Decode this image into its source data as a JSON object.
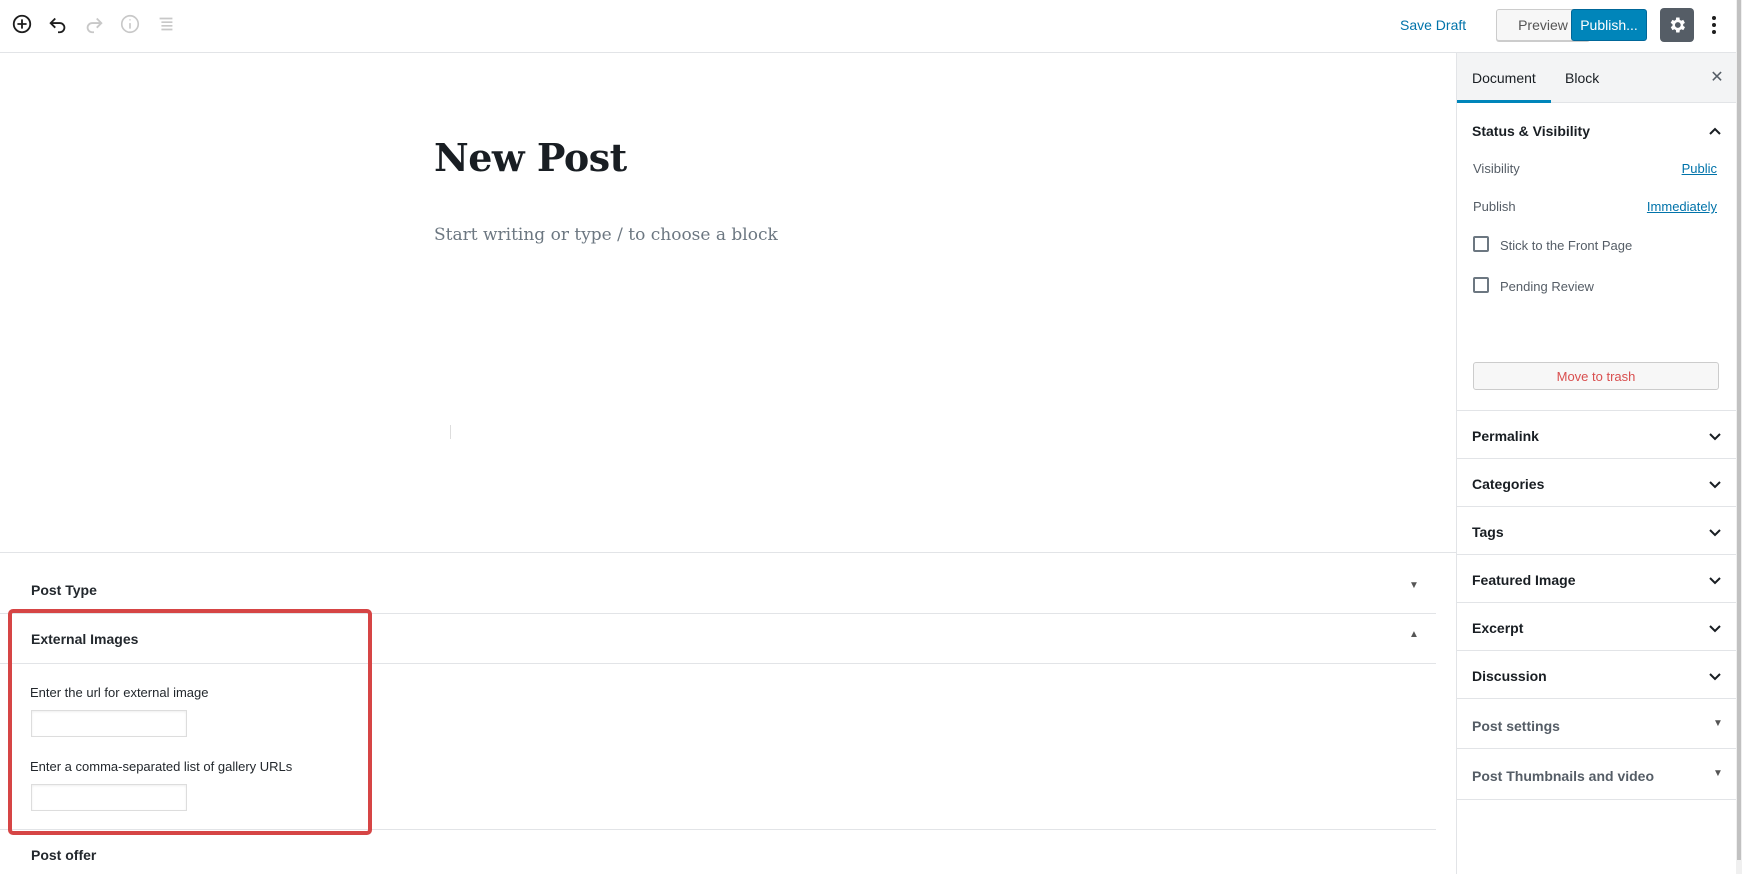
{
  "toolbar": {
    "icons": [
      "add-block-icon",
      "undo-icon",
      "redo-icon",
      "info-icon",
      "block-navigation-icon"
    ],
    "save_draft": "Save Draft",
    "preview": "Preview",
    "publish": "Publish...",
    "settings_icon": "gear-icon",
    "more_icon": "ellipsis-vertical-icon",
    "accent_color": "#0085ba"
  },
  "editor": {
    "title": "New Post",
    "placeholder": "Start writing or type / to choose a block"
  },
  "metaboxes": {
    "post_type": {
      "title": "Post Type",
      "state": "collapsed"
    },
    "external_images": {
      "title": "External Images",
      "state": "expanded",
      "url_label": "Enter the url for external image",
      "url_value": "",
      "gallery_label": "Enter a comma-separated list of gallery URLs",
      "gallery_value": ""
    },
    "post_offer": {
      "title": "Post offer"
    },
    "highlight_color": "#d64545"
  },
  "sidebar": {
    "tabs": [
      {
        "label": "Document",
        "active": true
      },
      {
        "label": "Block",
        "active": false
      }
    ],
    "status": {
      "title": "Status & Visibility",
      "visibility_label": "Visibility",
      "visibility_value": "Public",
      "publish_label": "Publish",
      "publish_value": "Immediately",
      "stick_label": "Stick to the Front Page",
      "stick_checked": false,
      "pending_label": "Pending Review",
      "pending_checked": false,
      "trash_label": "Move to trash"
    },
    "panels": [
      {
        "title": "Permalink"
      },
      {
        "title": "Categories"
      },
      {
        "title": "Tags"
      },
      {
        "title": "Featured Image"
      },
      {
        "title": "Excerpt"
      },
      {
        "title": "Discussion"
      },
      {
        "title": "Post settings"
      },
      {
        "title": "Post Thumbnails and video"
      }
    ]
  }
}
